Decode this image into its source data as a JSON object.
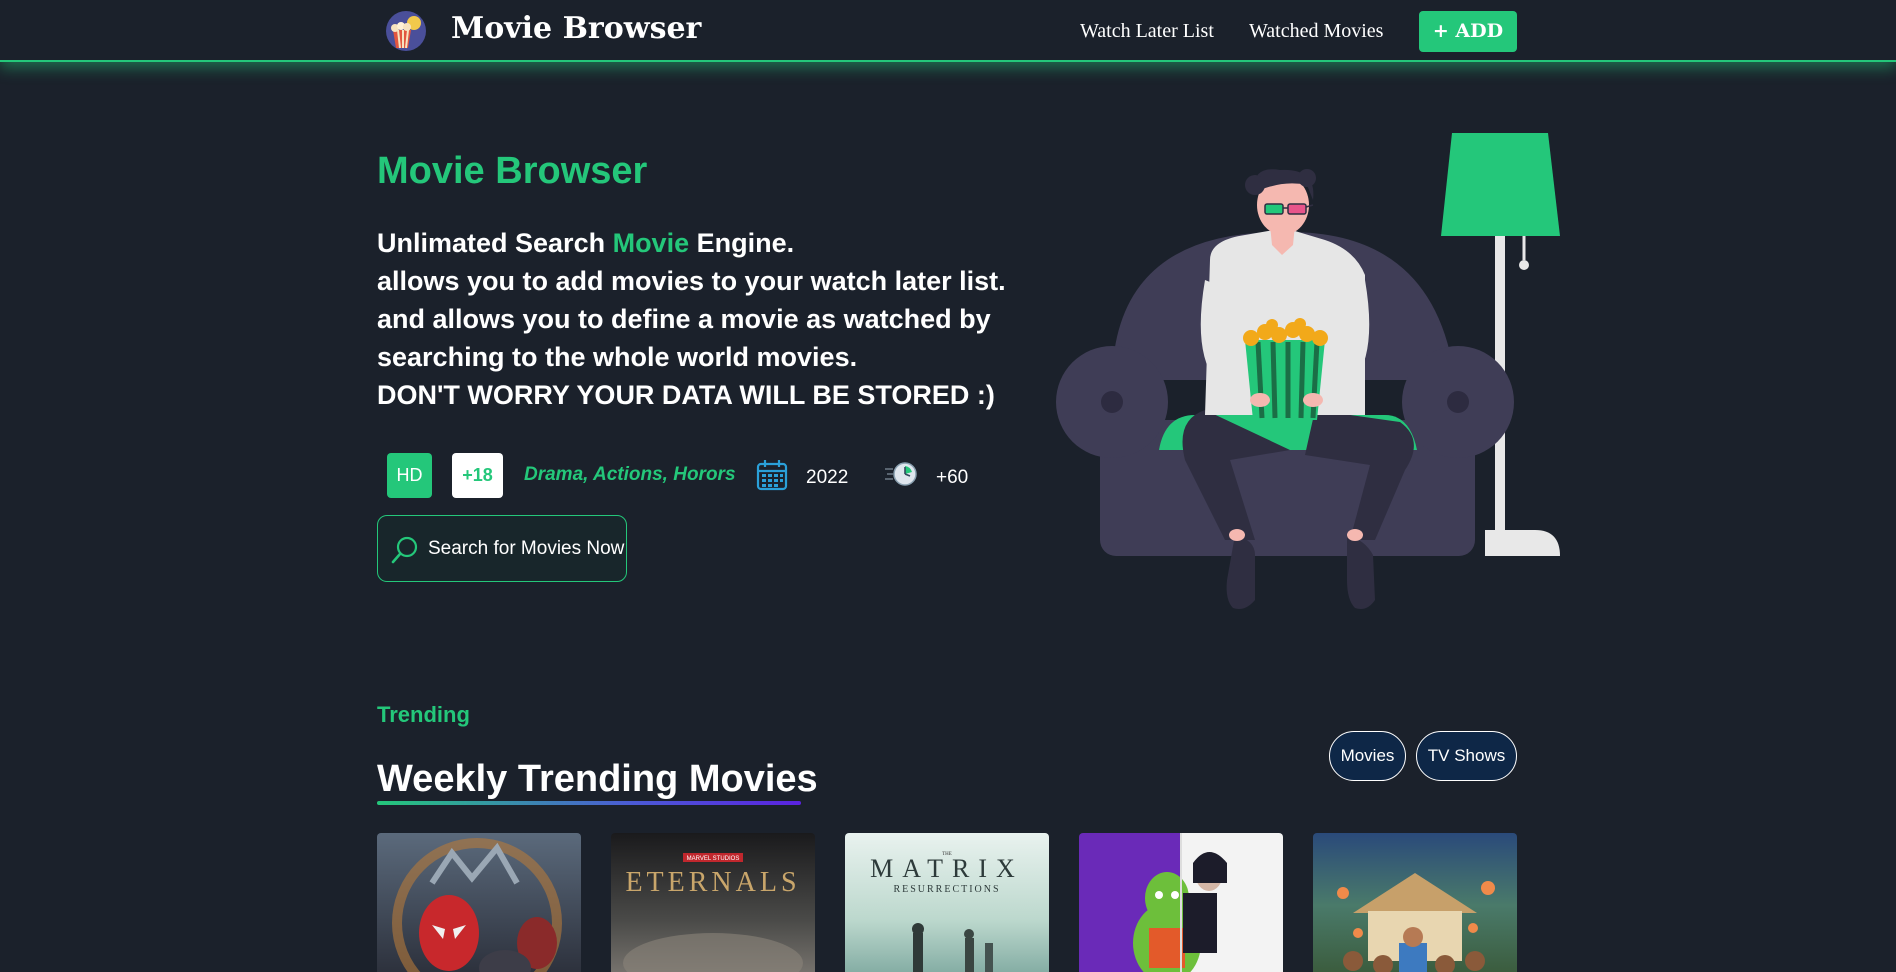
{
  "app": {
    "brand": "Movie Browser",
    "logo_icon": "popcorn-logo-icon"
  },
  "nav": {
    "watch_later": "Watch Later List",
    "watched": "Watched Movies",
    "add": "+ ADD"
  },
  "hero": {
    "title": "Movie Browser",
    "line1_before": "Unlimated Search ",
    "line1_accent": "Movie",
    "line1_after": " Engine.",
    "line2": "allows you to add movies to your watch later list.",
    "line3": "and allows you to define a movie as watched by searching to the whole world movies.",
    "line4": "DON'T WORRY YOUR DATA WILL BE STORED :)",
    "badges": {
      "quality": "HD",
      "age": "+18",
      "genres": "Drama, Actions, Horors",
      "year": "2022",
      "duration": "+60"
    },
    "search_button": "Search for Movies Now",
    "illustration": "person-watching-movie-on-couch"
  },
  "trending": {
    "tag": "Trending",
    "title": "Weekly Trending Movies",
    "toggles": [
      "Movies",
      "TV Shows"
    ],
    "posters": [
      {
        "name": "poster-spider-man",
        "text": ""
      },
      {
        "name": "poster-eternals",
        "text": "ETERNALS",
        "subtext": "MARVEL STUDIOS"
      },
      {
        "name": "poster-matrix",
        "text": "MATRIX",
        "subtext": "RESURRECTIONS",
        "prefix": "THE"
      },
      {
        "name": "poster-hotel-transylvania",
        "text": ""
      },
      {
        "name": "poster-encanto",
        "text": ""
      }
    ]
  },
  "colors": {
    "background": "#1b212b",
    "accent": "#24c77a",
    "toggle_bg": "#0e2747"
  }
}
